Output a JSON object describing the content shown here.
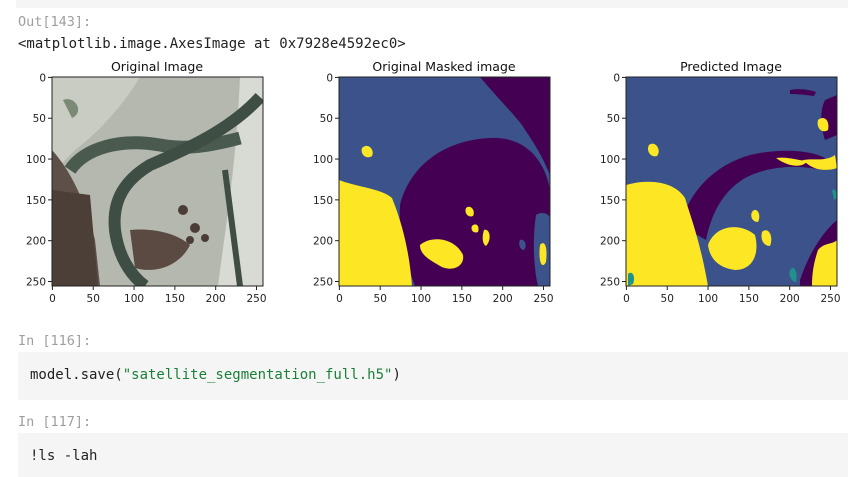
{
  "output_cell": {
    "prompt": "Out[143]:",
    "text": "<matplotlib.image.AxesImage at 0x7928e4592ec0>"
  },
  "figure": {
    "panels": [
      {
        "title": "Original Image"
      },
      {
        "title": "Original Masked image"
      },
      {
        "title": "Predicted Image"
      }
    ],
    "axis_ticks": {
      "x": [
        "0",
        "50",
        "100",
        "150",
        "200",
        "250"
      ],
      "y": [
        "0",
        "50",
        "100",
        "150",
        "200",
        "250"
      ]
    },
    "colors": {
      "mask_background": "#3b528b",
      "mask_dark": "#440154",
      "mask_yellow": "#fde725",
      "mask_teal": "#21918c"
    }
  },
  "cells": [
    {
      "prompt": "In [116]:",
      "code_prefix": "model.save(",
      "code_string": "\"satellite_segmentation_full.h5\"",
      "code_suffix": ")"
    },
    {
      "prompt": "In [117]:",
      "code": "!ls -lah"
    }
  ]
}
